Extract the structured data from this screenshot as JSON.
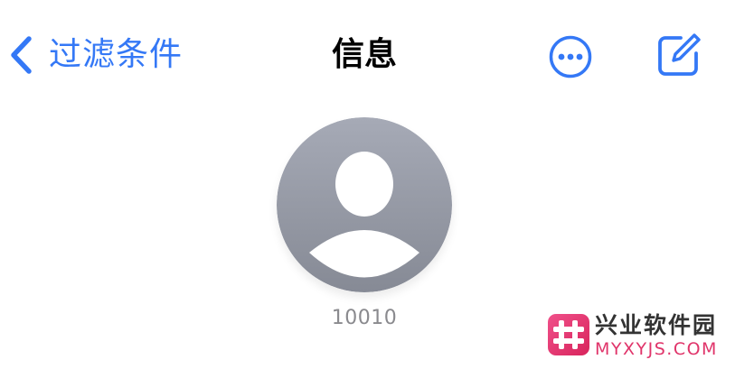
{
  "nav": {
    "back_label": "过滤条件",
    "title": "信息"
  },
  "icons": {
    "back": "chevron-left-icon",
    "more": "ellipsis-circle-icon",
    "compose": "compose-icon",
    "avatar": "person-silhouette-icon"
  },
  "contact": {
    "name": "10010"
  },
  "watermark": {
    "name_cn": "兴业软件园",
    "domain": "MYXYJS.COM"
  },
  "colors": {
    "accent": "#3478F6",
    "avatar_top": "#A6AAB6",
    "avatar_bottom": "#868A95",
    "secondary_text": "#8A8A8E",
    "watermark_pink": "#E0346A"
  }
}
